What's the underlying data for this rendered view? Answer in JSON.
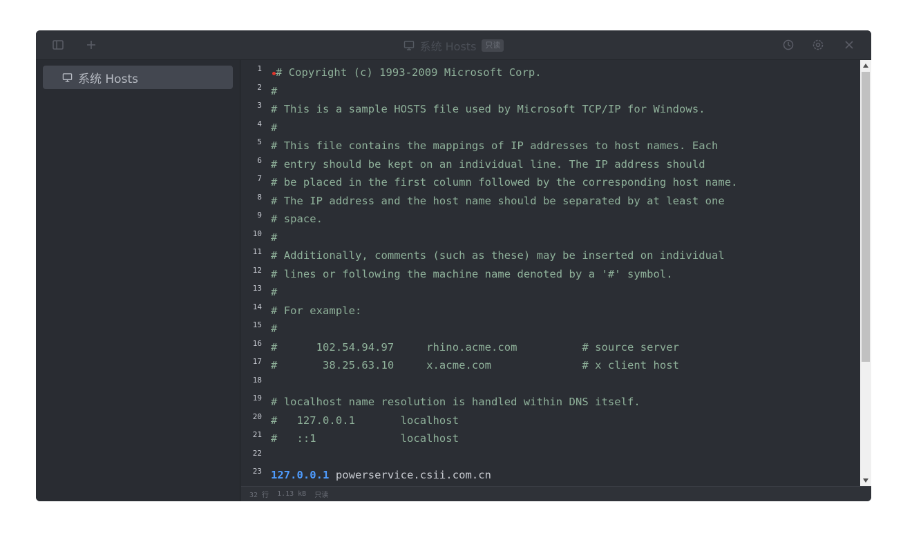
{
  "titlebar": {
    "title": "系统 Hosts",
    "badge": "只读",
    "left_icons": [
      "sidebar-toggle-icon",
      "plus-icon"
    ],
    "right_icons": [
      "history-icon",
      "gear-icon",
      "close-icon"
    ]
  },
  "sidebar": {
    "items": [
      {
        "label": "系统 Hosts",
        "icon": "monitor-icon",
        "selected": true
      }
    ]
  },
  "editor": {
    "lines": [
      {
        "n": "1",
        "text": "# Copyright (c) 1993-2009 Microsoft Corp."
      },
      {
        "n": "2",
        "text": "#"
      },
      {
        "n": "3",
        "text": "# This is a sample HOSTS file used by Microsoft TCP/IP for Windows."
      },
      {
        "n": "4",
        "text": "#"
      },
      {
        "n": "5",
        "text": "# This file contains the mappings of IP addresses to host names. Each"
      },
      {
        "n": "6",
        "text": "# entry should be kept on an individual line. The IP address should"
      },
      {
        "n": "7",
        "text": "# be placed in the first column followed by the corresponding host name."
      },
      {
        "n": "8",
        "text": "# The IP address and the host name should be separated by at least one"
      },
      {
        "n": "9",
        "text": "# space."
      },
      {
        "n": "10",
        "text": "#"
      },
      {
        "n": "11",
        "text": "# Additionally, comments (such as these) may be inserted on individual"
      },
      {
        "n": "12",
        "text": "# lines or following the machine name denoted by a '#' symbol."
      },
      {
        "n": "13",
        "text": "#"
      },
      {
        "n": "14",
        "text": "# For example:"
      },
      {
        "n": "15",
        "text": "#"
      },
      {
        "n": "16",
        "text": "#      102.54.94.97     rhino.acme.com          # source server"
      },
      {
        "n": "17",
        "text": "#       38.25.63.10     x.acme.com              # x client host"
      },
      {
        "n": "18",
        "text": ""
      },
      {
        "n": "19",
        "text": "# localhost name resolution is handled within DNS itself."
      },
      {
        "n": "20",
        "text": "#   127.0.0.1       localhost"
      },
      {
        "n": "21",
        "text": "#   ::1             localhost"
      },
      {
        "n": "22",
        "text": ""
      },
      {
        "n": "23",
        "ip": "127.0.0.1",
        "host": " powerservice.csii.com.cn"
      }
    ],
    "colors": {
      "comment": "#8fb19a",
      "ip": "#4e9cff",
      "host": "#c9ccd2",
      "marker": "#e0352b"
    }
  },
  "statusbar": {
    "lines": "32 行",
    "size": "1.13 kB",
    "mode": "只读"
  }
}
